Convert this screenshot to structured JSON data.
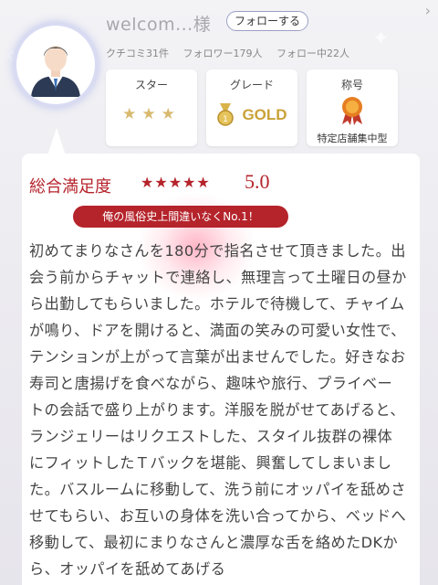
{
  "profile": {
    "username": "welcom...様",
    "follow_label": "フォローする",
    "stats": {
      "reviews": "クチコミ31件",
      "followers": "フォロワー179人",
      "following": "フォロー中22人"
    }
  },
  "badges": {
    "star": {
      "label": "スター",
      "stars": "★★★",
      "count": 3
    },
    "grade": {
      "label": "グレード",
      "value": "GOLD"
    },
    "title": {
      "label": "称号",
      "value": "特定店舗集中型"
    }
  },
  "review": {
    "satisfaction_label": "総合満足度",
    "stars": "★★★★★",
    "rating": 5,
    "score": "5.0",
    "headline": "俺の風俗史上間違いなくNo.1！",
    "body": "初めてまりなさんを180分で指名させて頂きました。出会う前からチャットで連絡し、無理言って土曜日の昼から出勤してもらいました。ホテルで待機して、チャイムが鳴り、ドアを開けると、満面の笑みの可愛い女性で、テンションが上がって言葉が出ませんでした。好きなお寿司と唐揚げを食べながら、趣味や旅行、プライベートの会話で盛り上がります。洋服を脱がせてあげると、ランジェリーはリクエストした、スタイル抜群の裸体にフィットしたＴバックを堪能、興奮してしまいました。バスルームに移動して、洗う前にオッパイを舐めさせてもらい、お互いの身体を洗い合ってから、ベッドへ移動して、最初にまりなさんと濃厚な舌を絡めたDKから、オッパイを舐めてあげる"
  },
  "colors": {
    "accent": "#b5232b",
    "gold": "#c9a238",
    "avatar_ring": "#d8dbf2"
  }
}
